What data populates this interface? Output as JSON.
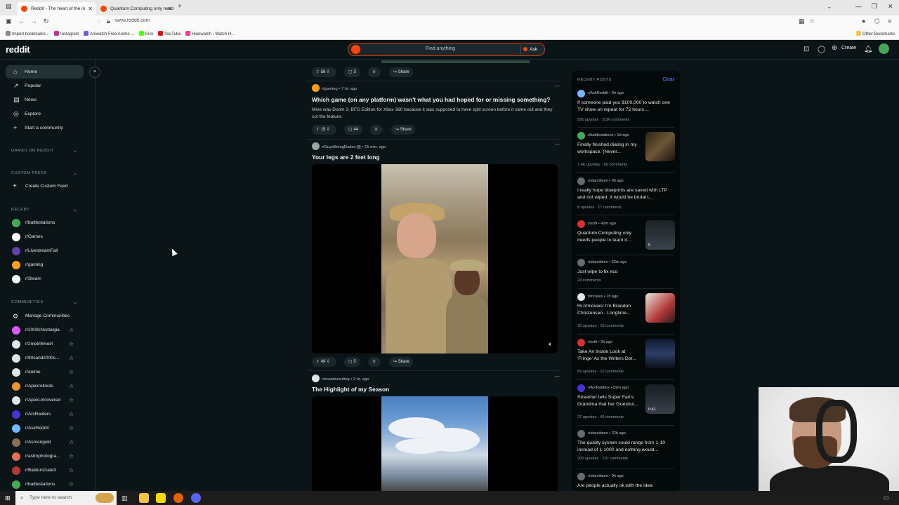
{
  "browser": {
    "tabs": [
      {
        "title": "Reddit - The heart of the in",
        "favicon_color": "#ff4500",
        "active": true
      },
      {
        "title": "Quantum Computing only need",
        "favicon_color": "#ff4500",
        "active": false
      }
    ],
    "new_tab": "+",
    "url": "www.reddit.com",
    "bookmarks": [
      {
        "label": "Import bookmarks...",
        "color": "#888888"
      },
      {
        "label": "Instagram",
        "color": "#d6249f"
      },
      {
        "label": "Aniwatch Free Anime ...",
        "color": "#6c5ce7"
      },
      {
        "label": "Kick",
        "color": "#53fc18"
      },
      {
        "label": "YouTube",
        "color": "#ff0000"
      },
      {
        "label": "Hianwatch - Watch H...",
        "color": "#e84393"
      }
    ],
    "other_bookmarks": "Other Bookmarks"
  },
  "header": {
    "logo": "reddit",
    "search_placeholder": "Find anything",
    "ask_label": "Ask",
    "create_label": "Create"
  },
  "sidebar": {
    "nav": [
      {
        "label": "Home",
        "icon": "home-icon",
        "glyph": "⌂",
        "active": true
      },
      {
        "label": "Popular",
        "icon": "popular-icon",
        "glyph": "↗"
      },
      {
        "label": "News",
        "icon": "news-icon",
        "glyph": "▤"
      },
      {
        "label": "Explore",
        "icon": "explore-icon",
        "glyph": "◎"
      },
      {
        "label": "Start a community",
        "icon": "plus-icon",
        "glyph": "+"
      }
    ],
    "sections": {
      "games": "GAMES ON REDDIT",
      "custom_feeds": "CUSTOM FEEDS",
      "recent": "RECENT",
      "communities": "COMMUNITIES"
    },
    "create_custom_feed": "Create Custom Feed",
    "recent": [
      {
        "name": "r/battlestations",
        "color": "#46a758"
      },
      {
        "name": "r/Games",
        "color": "#ffffff"
      },
      {
        "name": "r/LivestreamFail",
        "color": "#6441a5"
      },
      {
        "name": "r/gaming",
        "color": "#ff9f1a"
      },
      {
        "name": "r/Steam",
        "color": "#ffffff"
      }
    ],
    "manage_communities": "Manage Communities",
    "communities": [
      {
        "name": "r/2000sNostalgia",
        "color": "#e056fd"
      },
      {
        "name": "r/2meirl4meirl",
        "color": "#dfe6e9"
      },
      {
        "name": "r/90sand2000s...",
        "color": "#dfe6e9"
      },
      {
        "name": "r/anime",
        "color": "#dfe6e9"
      },
      {
        "name": "r/Apexrollouts",
        "color": "#f0932b"
      },
      {
        "name": "r/ApexUncovered",
        "color": "#dfe6e9"
      },
      {
        "name": "r/ArcRaiders",
        "color": "#4834d4"
      },
      {
        "name": "r/AskReddit",
        "color": "#74b9ff"
      },
      {
        "name": "r/Asmongold",
        "color": "#8e6e53"
      },
      {
        "name": "r/astrophotogra...",
        "color": "#e17055"
      },
      {
        "name": "r/BaldursGate3",
        "color": "#b33939"
      },
      {
        "name": "r/battlestations",
        "color": "#46a758"
      }
    ]
  },
  "feed": {
    "posts": [
      {
        "votes": "58",
        "comments": "3",
        "share": "Share"
      },
      {
        "subreddit": "r/gaming",
        "time": "7 hr. ago",
        "avatar_color": "#ff9f1a",
        "title": "Which game (on any platform) wasn't what you had hoped for or missing something?",
        "body": "Mine was Doom 3: BFG Edition for Xbox 360 because it was supposed to have split screen before it came out and they cut the feature.",
        "votes": "15",
        "comments": "44",
        "share": "Share"
      },
      {
        "subreddit": "r/GuysBeingDudes",
        "time": "25 min. ago",
        "avatar_color": "#95a5a6",
        "title": "Your legs are 2 feet long",
        "votes": "49",
        "comments": "5",
        "share": "Share"
      },
      {
        "subreddit": "r/snowboarding",
        "time": "2 hr. ago",
        "avatar_color": "#dfe6e9",
        "title": "The Highlight of my Season"
      }
    ]
  },
  "recent_posts": {
    "heading": "RECENT POSTS",
    "clear": "Clear",
    "items": [
      {
        "sub": "r/AskReddit",
        "time": "5h ago",
        "color": "#74b9ff",
        "title": "If someone paid you $100,000 to watch one TV show on repeat for 72 hours....",
        "upvotes": "591 upvotes",
        "comments": "3.5K comments"
      },
      {
        "sub": "r/battlestations",
        "time": "1d ago",
        "color": "#46a758",
        "title": "Finally finished dialing in my workspace. (Never...",
        "upvotes": "1.4K upvotes",
        "comments": "69 comments",
        "thumb": true
      },
      {
        "sub": "r/starcitizen",
        "time": "9h ago",
        "color": "#636e72",
        "title": "I really hope blueprints are saved with LTP and not wiped. It would be brutal t...",
        "upvotes": "8 upvotes",
        "comments": "17 comments"
      },
      {
        "sub": "r/scifi",
        "time": "42m ago",
        "color": "#d63031",
        "title": "Quantum Computing only needs people to learn it...",
        "upvotes": "",
        "comments": "",
        "thumb": true,
        "thumb_label": "5"
      },
      {
        "sub": "r/starcitizen",
        "time": "52m ago",
        "color": "#636e72",
        "title": "Just wipe to fix eco",
        "upvotes": "",
        "comments": "24 comments"
      },
      {
        "sub": "r/movies",
        "time": "1h ago",
        "color": "#dfe6e9",
        "title": "Hi /r/movies! I'm Brandon Christensen - Longtime...",
        "upvotes": "30 upvotes",
        "comments": "19 comments",
        "thumb": true
      },
      {
        "sub": "r/scifi",
        "time": "2h ago",
        "color": "#d63031",
        "title": "Take An Inside Look at 'Fringe' As the Writers Det...",
        "upvotes": "65 upvotes",
        "comments": "12 comments",
        "thumb": true
      },
      {
        "sub": "r/ArcRaiders",
        "time": "59m ago",
        "color": "#4834d4",
        "title": "Streamer tells Super Fan's Grandma that her Grandso...",
        "upvotes": "27 upvotes",
        "comments": "46 comments",
        "thumb": true,
        "thumb_label": "0:41"
      },
      {
        "sub": "r/starcitizen",
        "time": "22h ago",
        "color": "#636e72",
        "title": "The quality system could range from 1-10 instead of 1-1000 and nothing would...",
        "upvotes": "200 upvotes",
        "comments": "107 comments"
      },
      {
        "sub": "r/starcitizen",
        "time": "9h ago",
        "color": "#636e72",
        "title": "Are people actually ok with the idea",
        "upvotes": "",
        "comments": ""
      }
    ]
  },
  "taskbar": {
    "search_placeholder": "Type here to search"
  }
}
